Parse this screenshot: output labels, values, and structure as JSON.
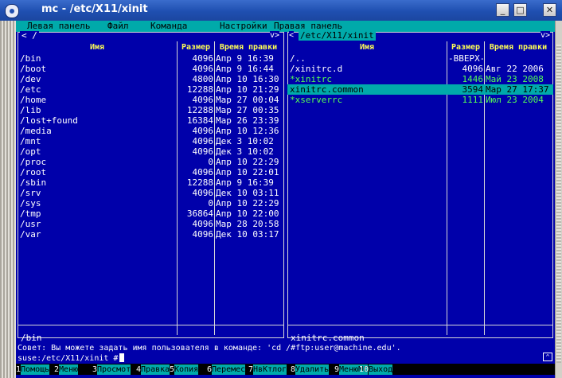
{
  "window": {
    "title": "mc - /etc/X11/xinit",
    "buttons": [
      "_",
      "□",
      "✕"
    ]
  },
  "menubar": [
    "Левая панель",
    "Файл",
    "Команда",
    "Настройки",
    "Правая панель"
  ],
  "left_panel": {
    "path": "< /",
    "corner": "v>",
    "columns": [
      "Имя",
      "Размер",
      "Время правки"
    ],
    "rows": [
      {
        "name": "/bin",
        "size": "4096",
        "time": "Апр  9 16:39"
      },
      {
        "name": "/boot",
        "size": "4096",
        "time": "Апр  9 16:44"
      },
      {
        "name": "/dev",
        "size": "4800",
        "time": "Апр 10 16:30"
      },
      {
        "name": "/etc",
        "size": "12288",
        "time": "Апр 10 21:29"
      },
      {
        "name": "/home",
        "size": "4096",
        "time": "Мар 27 00:04"
      },
      {
        "name": "/lib",
        "size": "12288",
        "time": "Мар 27 00:35"
      },
      {
        "name": "/lost+found",
        "size": "16384",
        "time": "Мар 26 23:39"
      },
      {
        "name": "/media",
        "size": "4096",
        "time": "Апр 10 12:36"
      },
      {
        "name": "/mnt",
        "size": "4096",
        "time": "Дек  3 10:02"
      },
      {
        "name": "/opt",
        "size": "4096",
        "time": "Дек  3 10:02"
      },
      {
        "name": "/proc",
        "size": "0",
        "time": "Апр 10 22:29"
      },
      {
        "name": "/root",
        "size": "4096",
        "time": "Апр 10 22:01"
      },
      {
        "name": "/sbin",
        "size": "12288",
        "time": "Апр  9 16:39"
      },
      {
        "name": "/srv",
        "size": "4096",
        "time": "Дек 10 03:11"
      },
      {
        "name": "/sys",
        "size": "0",
        "time": "Апр 10 22:29"
      },
      {
        "name": "/tmp",
        "size": "36864",
        "time": "Апр 10 22:00"
      },
      {
        "name": "/usr",
        "size": "4096",
        "time": "Мар 28 20:58"
      },
      {
        "name": "/var",
        "size": "4096",
        "time": "Дек 10 03:17"
      }
    ],
    "status": "/bin"
  },
  "right_panel": {
    "path": "/etc/X11/xinit",
    "corner": "v>",
    "columns": [
      "Имя",
      "Размер",
      "Время правки"
    ],
    "rows": [
      {
        "name": "/..",
        "size": "-ВВЕРХ-",
        "time": "",
        "type": "dir"
      },
      {
        "name": "/xinitrc.d",
        "size": "4096",
        "time": "Авг 22  2006",
        "type": "dir"
      },
      {
        "name": "*xinitrc",
        "size": "1446",
        "time": "Май 23  2008",
        "type": "exe"
      },
      {
        "name": " xinitrc.common",
        "size": "3594",
        "time": "Мар 27 17:37",
        "type": "sel"
      },
      {
        "name": "*xserverrc",
        "size": "1111",
        "time": "Июл 23  2004",
        "type": "exe"
      }
    ],
    "status": "xinitrc.common"
  },
  "hint": "Совет: Вы можете задать имя пользователя в команде: 'cd /#ftp:user@machine.edu'.",
  "command_line": "suse:/etc/X11/xinit #",
  "history_button": "^",
  "function_keys": [
    {
      "num": "1",
      "label": "Помощь"
    },
    {
      "num": "2",
      "label": "Меню"
    },
    {
      "num": "3",
      "label": "Просмот"
    },
    {
      "num": "4",
      "label": "Правка"
    },
    {
      "num": "5",
      "label": "Копия"
    },
    {
      "num": "6",
      "label": "Перемес"
    },
    {
      "num": "7",
      "label": "НвКтлог"
    },
    {
      "num": "8",
      "label": "Удалить"
    },
    {
      "num": "9",
      "label": "МенюMC"
    },
    {
      "num": "10",
      "label": "Выход"
    }
  ],
  "colors": {
    "panel_bg": "#0000aa",
    "accent_cyan": "#00aaaa",
    "header_yellow": "#ffff55",
    "exec_green": "#55ff55",
    "titlebar_blue": "#1f4fb0"
  }
}
